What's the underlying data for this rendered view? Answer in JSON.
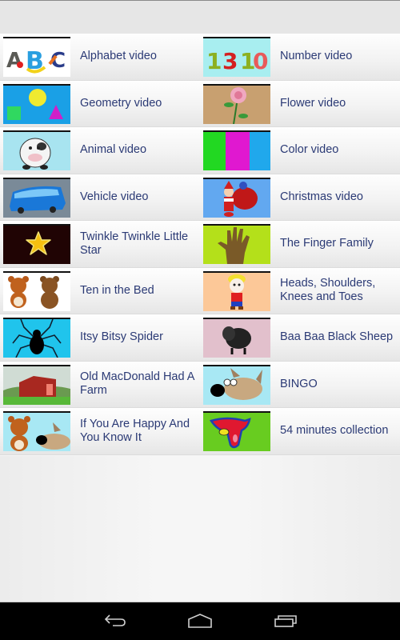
{
  "items": [
    {
      "title": "Alphabet video",
      "thumbnail": "abc-letters-icon"
    },
    {
      "title": "Number video",
      "thumbnail": "numbers-1-3-10-icon"
    },
    {
      "title": "Geometry video",
      "thumbnail": "shapes-icon"
    },
    {
      "title": "Flower video",
      "thumbnail": "rose-icon"
    },
    {
      "title": "Animal video",
      "thumbnail": "cow-icon"
    },
    {
      "title": "Color video",
      "thumbnail": "color-stripes-icon"
    },
    {
      "title": "Vehicle video",
      "thumbnail": "bus-icon"
    },
    {
      "title": "Christmas video",
      "thumbnail": "santa-icon"
    },
    {
      "title": "Twinkle Twinkle Little Star",
      "thumbnail": "star-icon"
    },
    {
      "title": "The Finger Family",
      "thumbnail": "hand-icon"
    },
    {
      "title": "Ten in the Bed",
      "thumbnail": "teddy-bears-icon"
    },
    {
      "title": "Heads, Shoulders, Knees and Toes",
      "thumbnail": "cartoon-boy-icon"
    },
    {
      "title": "Itsy Bitsy Spider",
      "thumbnail": "spider-icon"
    },
    {
      "title": "Baa Baa Black Sheep",
      "thumbnail": "black-sheep-icon"
    },
    {
      "title": "Old MacDonald Had A Farm",
      "thumbnail": "farm-barn-icon"
    },
    {
      "title": "BINGO",
      "thumbnail": "dog-icon"
    },
    {
      "title": "If You Are Happy And You Know It",
      "thumbnail": "bear-and-dog-icon"
    },
    {
      "title": "54 minutes collection",
      "thumbnail": "collection-splash-icon"
    }
  ],
  "navbar": {
    "back": "back-icon",
    "home": "home-icon",
    "recents": "recent-apps-icon"
  },
  "colors": {
    "label_text": "#2b3a75",
    "navbar": "#000000"
  }
}
